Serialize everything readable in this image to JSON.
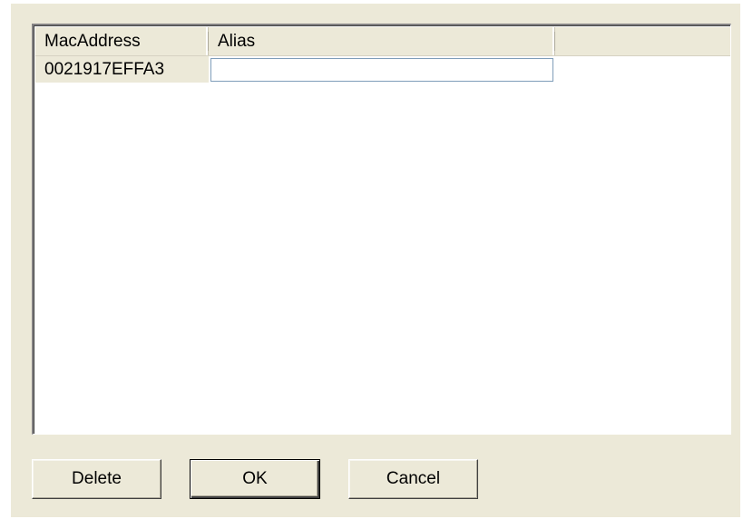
{
  "listview": {
    "columns": [
      "MacAddress",
      "Alias",
      ""
    ],
    "rows": [
      {
        "mac_address": "0021917EFFA3",
        "alias": ""
      }
    ]
  },
  "buttons": {
    "delete_label": "Delete",
    "ok_label": "OK",
    "cancel_label": "Cancel"
  },
  "colors": {
    "dialog_background": "#ece9d8",
    "list_background": "#ffffff",
    "edit_border": "#7f9db9"
  }
}
